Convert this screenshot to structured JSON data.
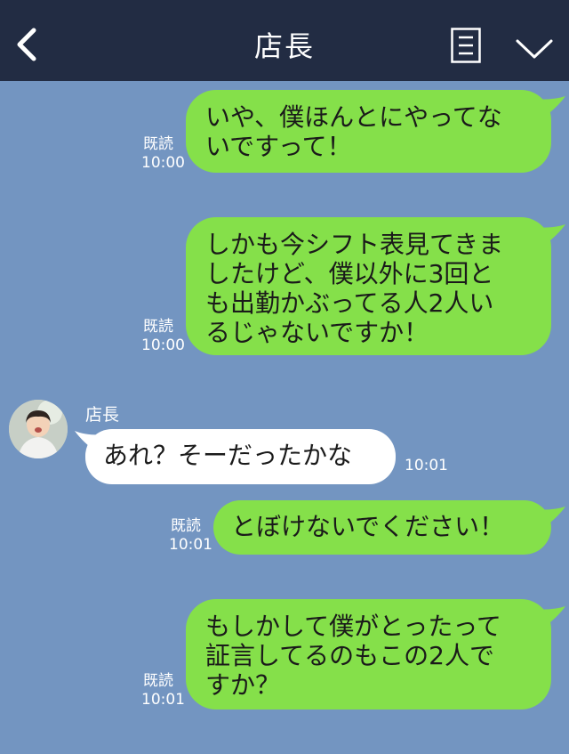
{
  "header": {
    "title": "店長"
  },
  "messages": [
    {
      "text": "いや、僕ほんとにやってな\nいですって！",
      "read": "既読",
      "time": "10:00"
    },
    {
      "text": "しかも今シフト表見てきま\nしたけど、僕以外に3回と\nも出勤かぶってる人2人い\nるじゃないですか！",
      "read": "既読",
      "time": "10:00"
    },
    {
      "sender": "店長",
      "text": "あれ？そーだったかな",
      "time": "10:01"
    },
    {
      "text": "とぼけないでください！",
      "read": "既読",
      "time": "10:01"
    },
    {
      "text": "もしかして僕がとったって\n証言してるのもこの2人で\nすか？",
      "read": "既読",
      "time": "10:01"
    }
  ],
  "colors": {
    "header": "#222c43",
    "background": "#7395c1",
    "my_bubble": "#85e04a",
    "their_bubble": "#ffffff"
  },
  "icons": [
    "back-arrow-icon",
    "menu-icon",
    "chevron-down-icon"
  ]
}
